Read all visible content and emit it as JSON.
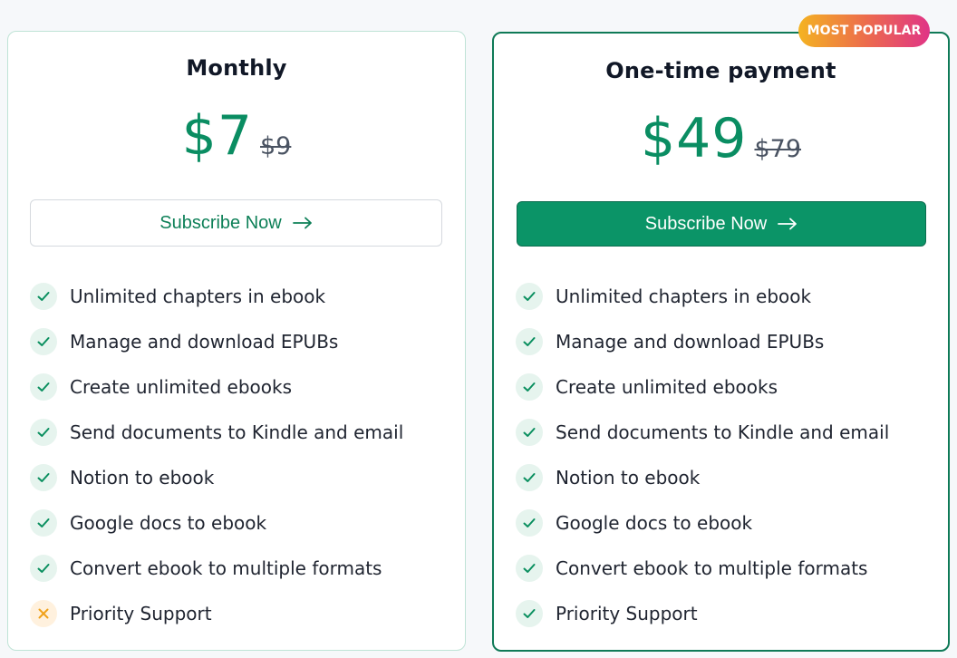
{
  "plans": [
    {
      "title": "Monthly",
      "price": "$7",
      "original_price": "$9",
      "cta_label": "Subscribe Now",
      "features": [
        {
          "label": "Unlimited chapters in ebook",
          "included": true
        },
        {
          "label": "Manage and download EPUBs",
          "included": true
        },
        {
          "label": "Create unlimited ebooks",
          "included": true
        },
        {
          "label": "Send documents to Kindle and email",
          "included": true
        },
        {
          "label": "Notion to ebook",
          "included": true
        },
        {
          "label": "Google docs to ebook",
          "included": true
        },
        {
          "label": "Convert ebook to multiple formats",
          "included": true
        },
        {
          "label": "Priority Support",
          "included": false
        }
      ]
    },
    {
      "title": "One-time payment",
      "price": "$49",
      "original_price": "$79",
      "cta_label": "Subscribe Now",
      "badge": "MOST POPULAR",
      "features": [
        {
          "label": "Unlimited chapters in ebook",
          "included": true
        },
        {
          "label": "Manage and download EPUBs",
          "included": true
        },
        {
          "label": "Create unlimited ebooks",
          "included": true
        },
        {
          "label": "Send documents to Kindle and email",
          "included": true
        },
        {
          "label": "Notion to ebook",
          "included": true
        },
        {
          "label": "Google docs to ebook",
          "included": true
        },
        {
          "label": "Convert ebook to multiple formats",
          "included": true
        },
        {
          "label": "Priority Support",
          "included": true
        }
      ]
    }
  ],
  "icons": {
    "included": "check-icon",
    "excluded": "close-icon",
    "cta": "arrow-right-icon"
  },
  "colors": {
    "brand_green": "#0b9467",
    "price_green": "#0a8d62",
    "check_green": "#0a8f5f",
    "excluded_orange": "#f0a11a",
    "badge_gradient_start": "#f4b321",
    "badge_gradient_end": "#e03486"
  }
}
